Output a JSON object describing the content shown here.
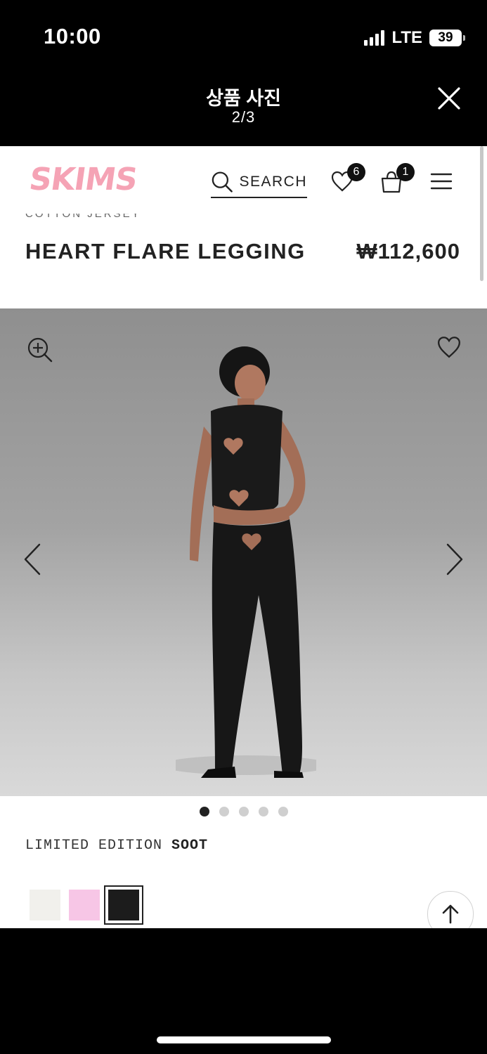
{
  "status_bar": {
    "time": "10:00",
    "network": "LTE",
    "battery": "39"
  },
  "viewer": {
    "title": "상품 사진",
    "counter": "2/3"
  },
  "site": {
    "logo": "SKIMS",
    "search_label": "SEARCH",
    "wishlist_count": "6",
    "cart_count": "1"
  },
  "product": {
    "collection": "COTTON JERSEY",
    "name": "HEART FLARE LEGGING",
    "price": "₩112,600",
    "color_prefix": "LIMITED EDITION",
    "color_name": "SOOT"
  },
  "gallery": {
    "image_count": 5,
    "active_index": 0
  },
  "swatches": [
    {
      "color": "#f1f0ec",
      "selected": false
    },
    {
      "color": "#f7c6e6",
      "selected": false
    },
    {
      "color": "#1c1c1c",
      "selected": true
    }
  ],
  "colors": {
    "accent_pink": "#f5a3b5",
    "text": "#222222"
  },
  "icons": [
    "close-icon",
    "search-icon",
    "heart-icon",
    "bag-icon",
    "menu-icon",
    "zoom-in-icon",
    "chevron-left-icon",
    "chevron-right-icon",
    "arrow-up-icon"
  ]
}
